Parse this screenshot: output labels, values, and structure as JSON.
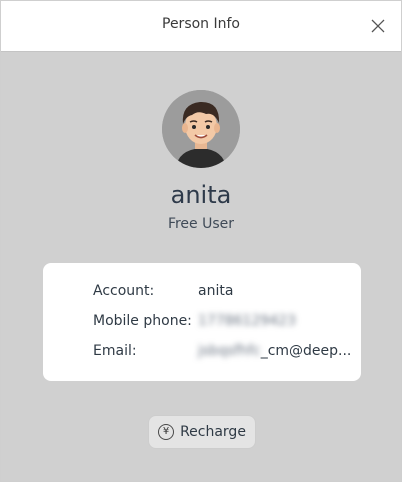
{
  "window": {
    "title": "Person Info"
  },
  "profile": {
    "username": "anita",
    "user_type": "Free User"
  },
  "info": {
    "account_label": "Account:",
    "account_value": "anita",
    "mobile_label": "Mobile phone:",
    "mobile_value": "17786129423",
    "email_label": "Email:",
    "email_value_blurred": "jsbqsfhfc",
    "email_value_visible": "_cm@deep..."
  },
  "actions": {
    "recharge_label": "Recharge",
    "recharge_icon_symbol": "¥"
  },
  "icons": {
    "close": "close-icon",
    "recharge": "yen-circle-icon",
    "avatar": "avatar"
  }
}
